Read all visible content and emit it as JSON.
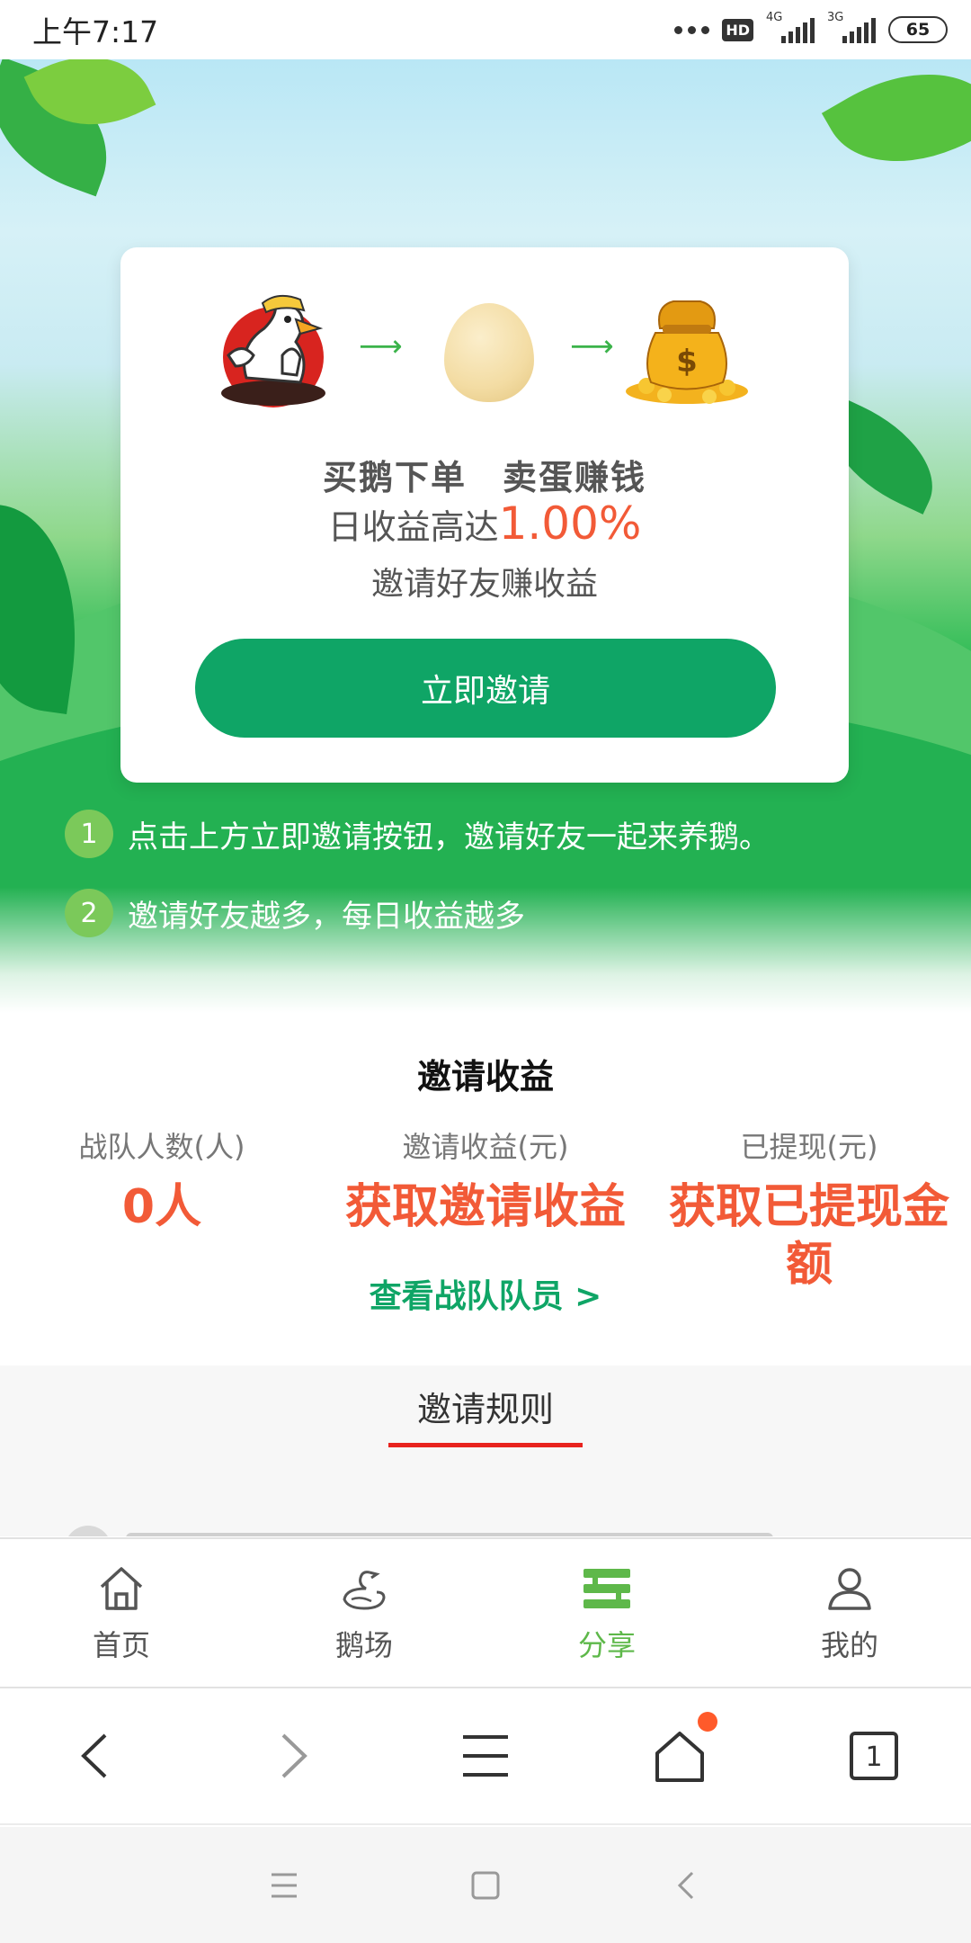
{
  "status_bar": {
    "time": "上午7:17",
    "hd": "HD",
    "net1": "4G",
    "net2": "3G",
    "battery": "65"
  },
  "card": {
    "line1": "买鹅下单　卖蛋赚钱",
    "line2_prefix": "日收益高达",
    "line2_rate": "1.00%",
    "line3": "邀请好友赚收益",
    "invite_button": "立即邀请"
  },
  "steps": [
    {
      "num": "1",
      "text": "点击上方立即邀请按钮，邀请好友一起来养鹅。"
    },
    {
      "num": "2",
      "text": "邀请好友越多，每日收益越多"
    }
  ],
  "earnings": {
    "title": "邀请收益",
    "stats": [
      {
        "label": "战队人数(人)",
        "value": "0人"
      },
      {
        "label": "邀请收益(元)",
        "value": "获取邀请收益"
      },
      {
        "label": "已提现(元)",
        "value": "获取已提现金额"
      }
    ],
    "view_team": "查看战队队员 >"
  },
  "rules": {
    "tab_label": "邀请规则"
  },
  "tabbar": [
    {
      "label": "首页",
      "icon": "home-icon",
      "active": false
    },
    {
      "label": "鹅场",
      "icon": "goose-icon",
      "active": false
    },
    {
      "label": "分享",
      "icon": "share-icon",
      "active": true
    },
    {
      "label": "我的",
      "icon": "user-icon",
      "active": false
    }
  ],
  "browser_toolbar": {
    "tab_count": "1"
  },
  "colors": {
    "accent_green": "#0fa566",
    "orange": "#f25a37",
    "active_tab": "#5eb84a",
    "underline_red": "#e8231e"
  }
}
